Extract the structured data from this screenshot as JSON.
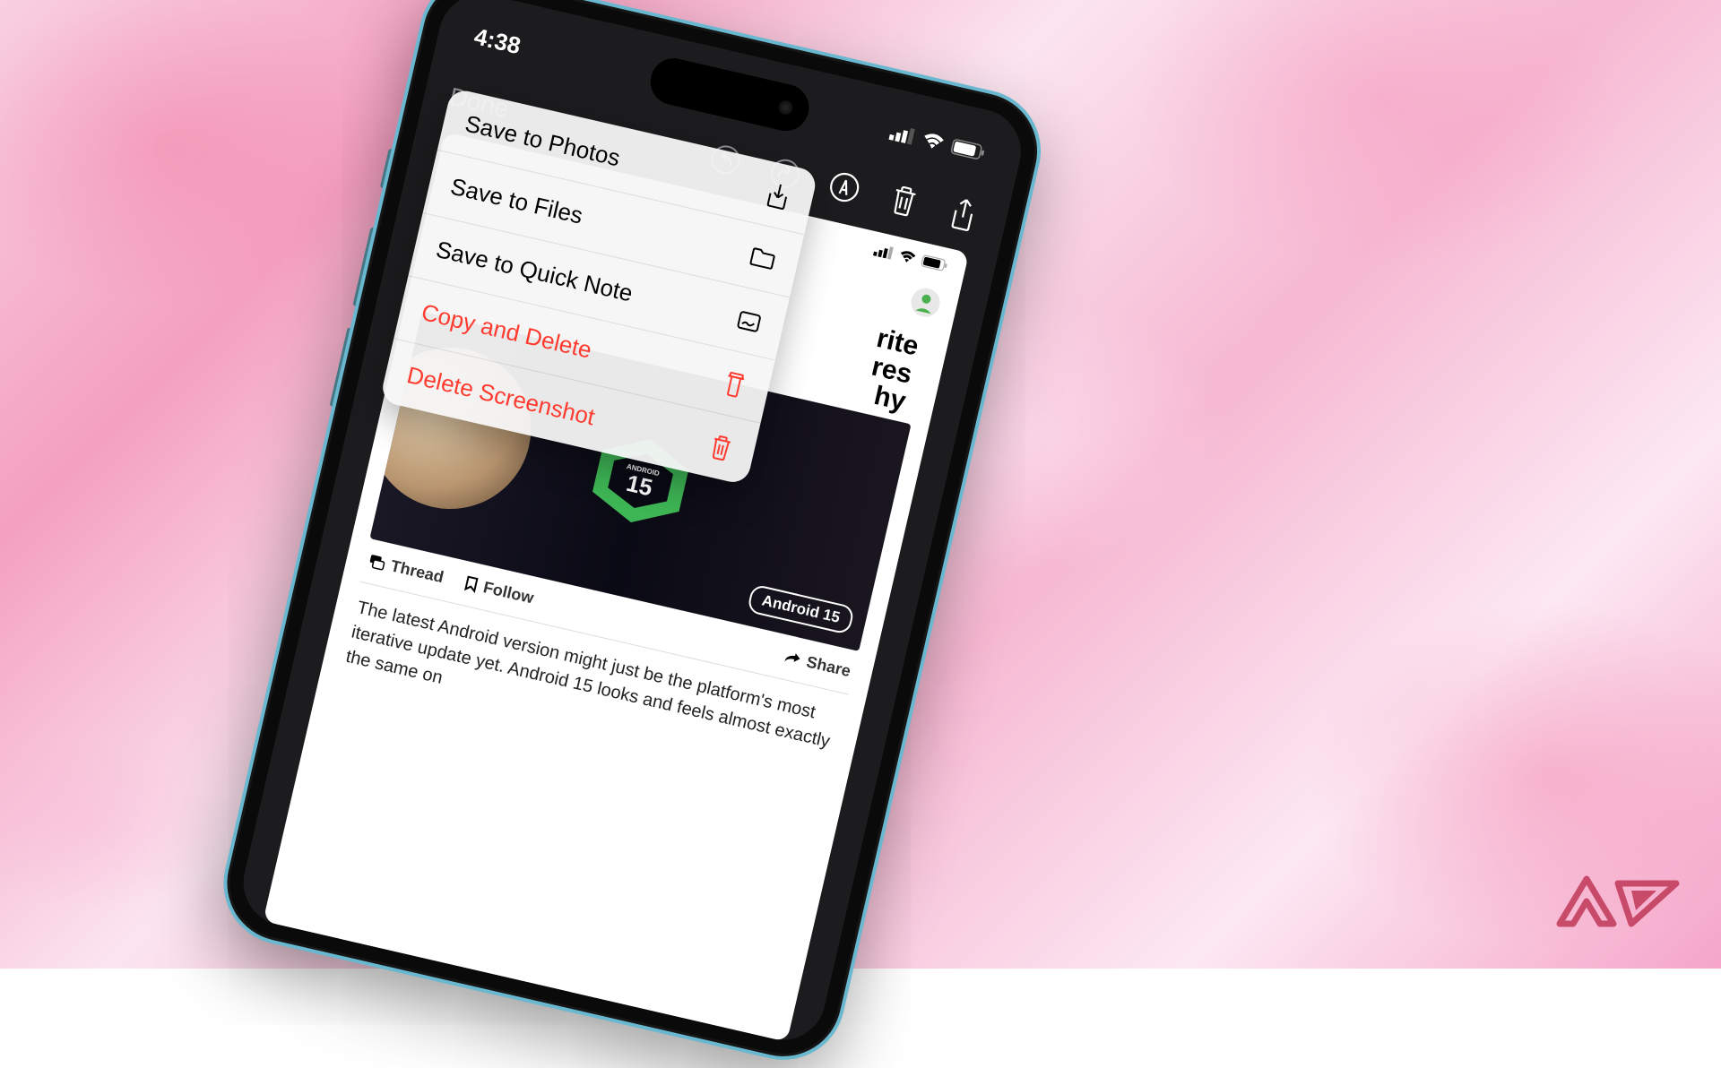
{
  "status": {
    "time": "4:38"
  },
  "navbar": {
    "done": "Done"
  },
  "menu": {
    "save_photos": "Save to Photos",
    "save_files": "Save to Files",
    "save_quicknote": "Save to Quick Note",
    "copy_delete": "Copy and Delete",
    "delete_screenshot": "Delete Screenshot"
  },
  "article": {
    "peek_lines": {
      "l1": "rite",
      "l2": "res",
      "l3": "hy"
    },
    "tag": "Android 15",
    "badge_text": "15",
    "badge_label": "ANDROID",
    "meta": {
      "thread": "Thread",
      "follow": "Follow",
      "share": "Share"
    },
    "body": "The latest Android version might just be the platform's most iterative update yet. Android 15 looks and feels almost exactly the same on"
  },
  "icons": {
    "undo": "undo-icon",
    "redo": "redo-icon",
    "markup": "markup-icon",
    "trash": "trash-icon",
    "share": "share-icon",
    "download": "download-icon",
    "folder": "folder-icon",
    "note": "note-icon",
    "copy": "copy-trash-icon"
  }
}
